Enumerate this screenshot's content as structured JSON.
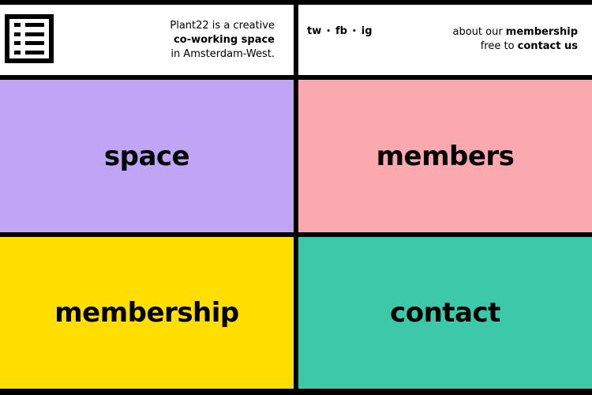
{
  "header": {
    "logo_icon": "grid-menu-icon",
    "tagline": {
      "line1": "Plant22 is a creative",
      "line2_bold": "co-working space",
      "line3": "in Amsterdam-West."
    },
    "social": [
      {
        "label": "tw"
      },
      {
        "label": "fb"
      },
      {
        "label": "ig"
      }
    ],
    "social_separator": "•",
    "right": {
      "line1_prefix": "about our ",
      "line1_link": "membership",
      "line2_prefix": "free to ",
      "line2_link": "contact us"
    }
  },
  "tiles": [
    {
      "label": "space",
      "color": "#C0A4F5"
    },
    {
      "label": "members",
      "color": "#FBA8AE"
    },
    {
      "label": "membership",
      "color": "#FFDE00"
    },
    {
      "label": "contact",
      "color": "#3CC9A9"
    }
  ],
  "colors": {
    "frame": "#000000",
    "header_bg": "#FFFFFF"
  }
}
